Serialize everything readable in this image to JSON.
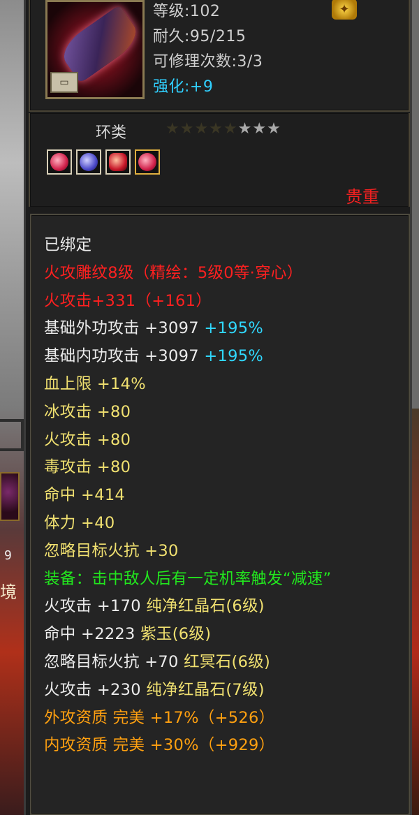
{
  "header": {
    "level": "等级:102",
    "durability": "耐久:95/215",
    "repair_count": "可修理次数:3/3",
    "enhance_label": "强化:",
    "enhance_value": "+9"
  },
  "category": "环类",
  "stars": {
    "total": 8,
    "lit": 3,
    "dim_glyph": "★★★★★",
    "lit_glyph": "★★★"
  },
  "gems": [
    "red-gem-icon",
    "blue-gem-icon",
    "red-gem-icon",
    "red-gem-icon"
  ],
  "rarity": "贵重",
  "bound": "已绑定",
  "engraving": "火攻雕纹8级（精绘：5级0等·穿心）",
  "fire_attack_top": "火攻击+331（+161）",
  "base_outer": {
    "label": "基础外功攻击 +3097",
    "bonus": " +195%"
  },
  "base_inner": {
    "label": "基础内功攻击 +3097",
    "bonus": " +195%"
  },
  "yellow_stats": [
    "血上限 +14%",
    "冰攻击 +80",
    "火攻击 +80",
    "毒攻击 +80",
    "命中 +414",
    "体力 +40",
    "忽略目标火抗 +30"
  ],
  "equip_effect": "装备：击中敌人后有一定机率触发“减速”",
  "gem_stats": [
    {
      "stat": "火攻击 +170",
      "gem": "纯净红晶石(6级)"
    },
    {
      "stat": "命中 +2223",
      "gem": "紫玉(6级)"
    },
    {
      "stat": "忽略目标火抗 +70",
      "gem": "红冥石(6级)"
    },
    {
      "stat": "火攻击 +230",
      "gem": "纯净红晶石(7级)"
    }
  ],
  "aptitudes": [
    "外攻资质  完美 +17%（+526）",
    "内攻资质  完美 +30%（+929）"
  ],
  "side": {
    "number": "9",
    "glyph": "境"
  },
  "colors": {
    "white": "#ececec",
    "red": "#ff2020",
    "yellow": "#f0e070",
    "cyan": "#30d8ff",
    "green": "#22e61e",
    "orange": "#ffa010"
  }
}
